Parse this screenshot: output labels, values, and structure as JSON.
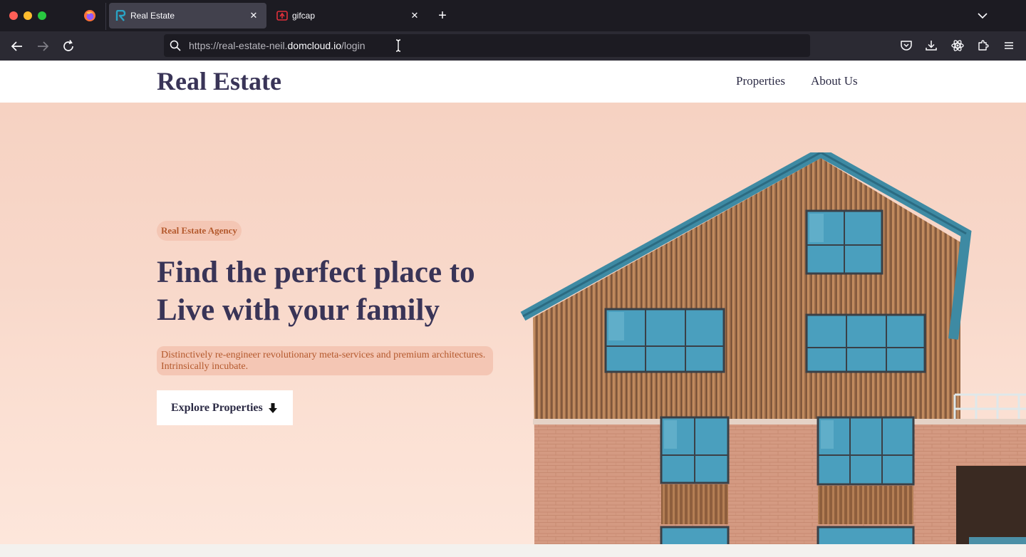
{
  "browser": {
    "tabs": [
      {
        "title": "Real Estate",
        "active": true
      },
      {
        "title": "gifcap",
        "active": false
      }
    ],
    "url": {
      "prefix": "https://real-estate-neil.",
      "domain": "domcloud.io",
      "path": "/login"
    }
  },
  "site": {
    "brand": "Real Estate",
    "nav": {
      "properties": "Properties",
      "about": "About Us"
    }
  },
  "hero": {
    "badge": "Real Estate Agency",
    "headline": "Find the perfect place to Live with your family",
    "lead": "Distinctively re-engineer revolutionary meta-services and premium architectures. Intrinsically incubate.",
    "cta": "Explore Properties"
  },
  "colors": {
    "brand_text": "#393457",
    "accent": "#b4592d",
    "badge_bg": "#f4c6b4",
    "hero_bg": "#f8d8ca",
    "window_blue": "#4a9fbe"
  }
}
